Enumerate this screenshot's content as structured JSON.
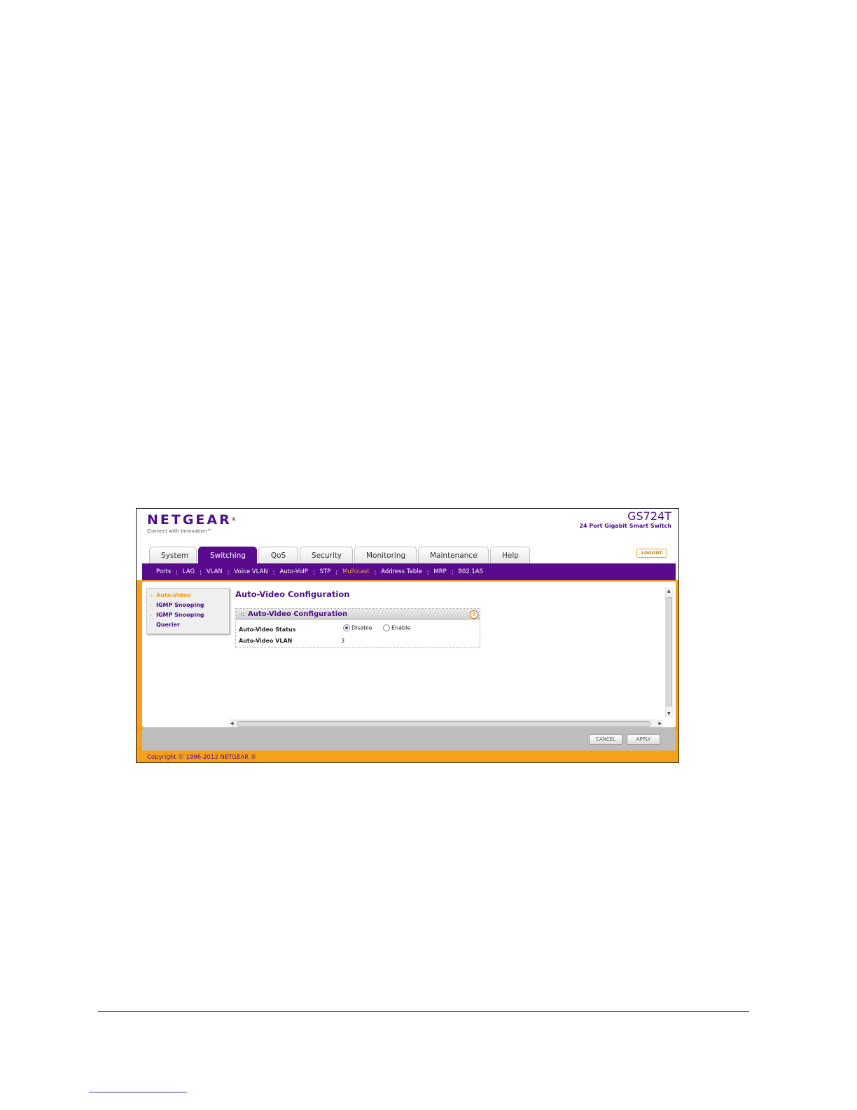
{
  "header": {
    "brand": "NETGEAR",
    "tagline": "Connect with Innovation™",
    "model": "GS724T",
    "model_desc": "24 Port Gigabit Smart Switch",
    "logout_label": "LOGOUT"
  },
  "tabs": [
    {
      "label": "System"
    },
    {
      "label": "Switching"
    },
    {
      "label": "QoS"
    },
    {
      "label": "Security"
    },
    {
      "label": "Monitoring"
    },
    {
      "label": "Maintenance"
    },
    {
      "label": "Help"
    }
  ],
  "active_tab": "Switching",
  "subnav": [
    {
      "label": "Ports"
    },
    {
      "label": "LAG"
    },
    {
      "label": "VLAN"
    },
    {
      "label": "Voice VLAN"
    },
    {
      "label": "Auto-VoIP"
    },
    {
      "label": "STP"
    },
    {
      "label": "Multicast"
    },
    {
      "label": "Address Table"
    },
    {
      "label": "MRP"
    },
    {
      "label": "802.1AS"
    }
  ],
  "active_subnav": "Multicast",
  "leftnav": [
    {
      "label": "Auto-Video",
      "marker": "»"
    },
    {
      "label": "IGMP Snooping",
      "marker": "›"
    },
    {
      "label": "IGMP Snooping",
      "marker": "›"
    },
    {
      "label": "Querier",
      "marker": ""
    }
  ],
  "page": {
    "title": "Auto-Video Configuration",
    "panel_title": "Auto-Video Configuration",
    "help_icon": "?",
    "status_label": "Auto-Video Status",
    "status_options": [
      "Disable",
      "Enable"
    ],
    "status_selected": "Disable",
    "vlan_label": "Auto-Video VLAN",
    "vlan_value": "3"
  },
  "buttons": {
    "cancel": "CANCEL",
    "apply": "APPLY"
  },
  "footer": {
    "copyright": "Copyright © 1996-2012 NETGEAR ®"
  },
  "colors": {
    "brand_purple": "#5a0a8c",
    "accent_orange": "#f7a11a"
  }
}
